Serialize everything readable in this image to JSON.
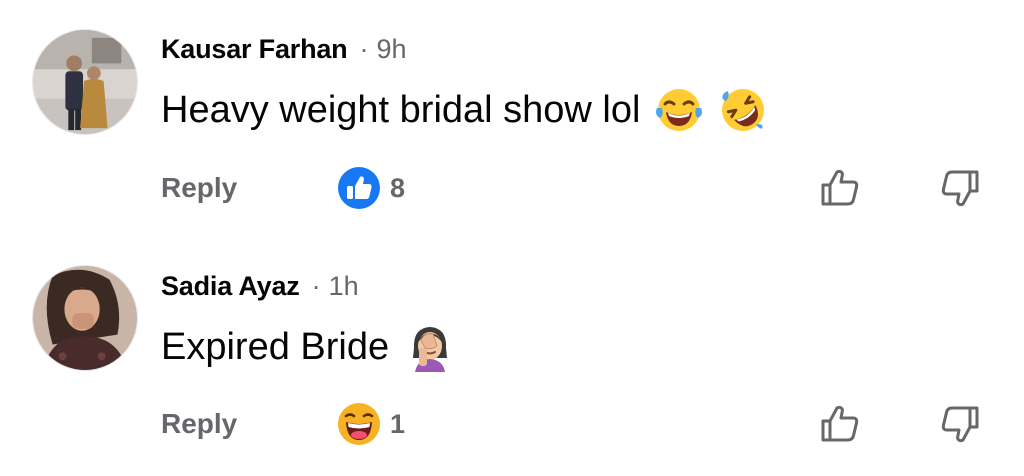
{
  "comments": [
    {
      "author": "Kausar Farhan",
      "separator": "·",
      "time": "9h",
      "text": "Heavy weight bridal show lol",
      "emojis": [
        "face-with-tears-of-joy",
        "rolling-on-floor-laughing"
      ],
      "reply_label": "Reply",
      "reaction": {
        "type": "like",
        "count": "8",
        "color": "#1877f2"
      },
      "upvote_icon": "thumbs-up-outline-icon",
      "downvote_icon": "thumbs-down-outline-icon"
    },
    {
      "author": "Sadia Ayaz",
      "separator": "·",
      "time": "1h",
      "text": "Expired Bride",
      "emojis": [
        "woman-facepalming"
      ],
      "reply_label": "Reply",
      "reaction": {
        "type": "haha",
        "count": "1",
        "color": "#f7b125"
      },
      "upvote_icon": "thumbs-up-outline-icon",
      "downvote_icon": "thumbs-down-outline-icon"
    }
  ],
  "colors": {
    "primary_text": "#050505",
    "secondary_text": "#65676b",
    "like_blue": "#1877f2",
    "emoji_yellow": "#f7b125"
  }
}
